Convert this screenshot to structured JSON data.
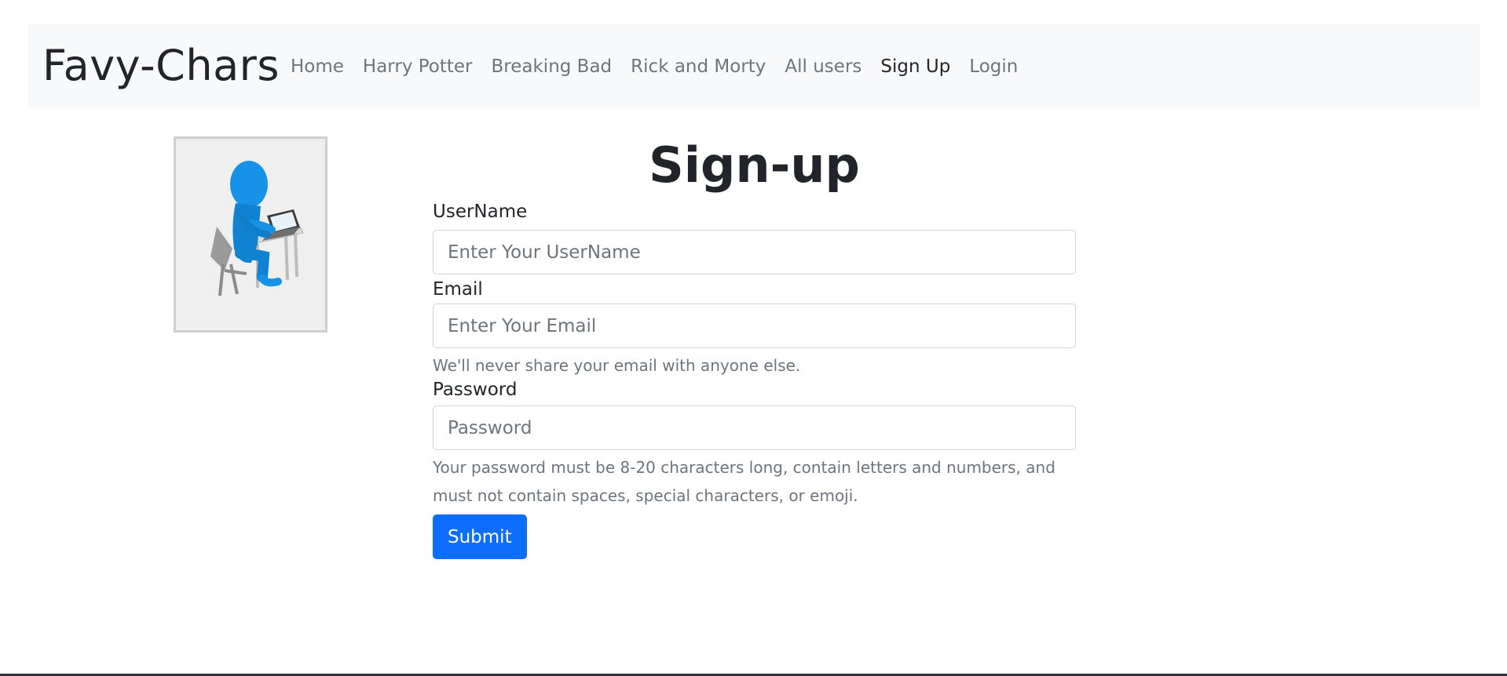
{
  "nav": {
    "brand": "Favy-Chars",
    "links": [
      {
        "label": "Home",
        "active": false
      },
      {
        "label": "Harry Potter",
        "active": false
      },
      {
        "label": "Breaking Bad",
        "active": false
      },
      {
        "label": "Rick and Morty",
        "active": false
      },
      {
        "label": "All users",
        "active": false
      },
      {
        "label": "Sign Up",
        "active": true
      },
      {
        "label": "Login",
        "active": false
      }
    ]
  },
  "illustration": {
    "icon": "person-at-laptop-icon"
  },
  "form": {
    "title": "Sign-up",
    "username": {
      "label": "UserName",
      "placeholder": "Enter Your UserName",
      "value": ""
    },
    "email": {
      "label": "Email",
      "placeholder": "Enter Your Email",
      "value": "",
      "help": "We'll never share your email with anyone else."
    },
    "password": {
      "label": "Password",
      "placeholder": "Password",
      "value": "",
      "help": "Your password must be 8-20 characters long, contain letters and numbers, and must not contain spaces, special characters, or emoji."
    },
    "submit_label": "Submit"
  },
  "colors": {
    "primary": "#0d6efd",
    "navbar_bg": "#f8f9fa",
    "muted_text": "#6c757d"
  }
}
